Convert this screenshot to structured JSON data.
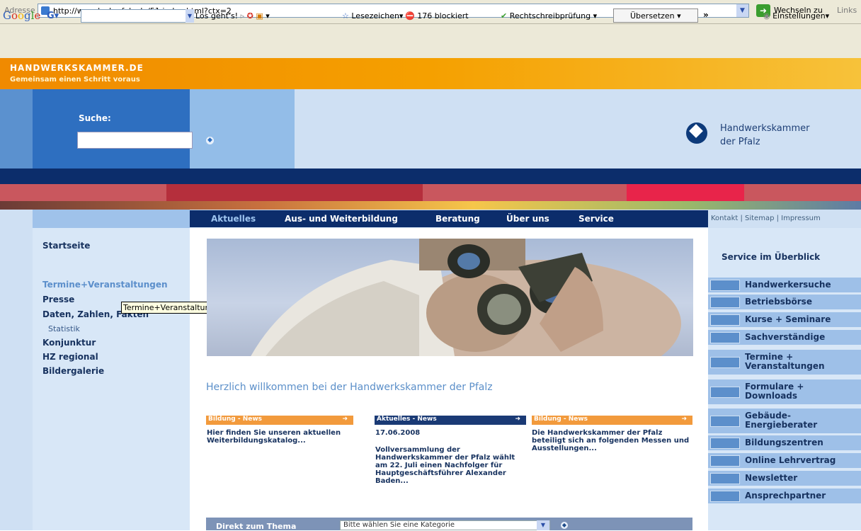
{
  "browser": {
    "address_label": "Adresse",
    "url": "http://www.hwk-pfalz.de/51,index.html?ctx=2",
    "go_label": "Wechseln zu",
    "links_label": "Links"
  },
  "google_toolbar": {
    "logo": "Google",
    "g_button": "G▾",
    "search_go": "Los geht's!",
    "bookmarks": "Lesezeichen▾",
    "blocked": "176 blockiert",
    "spellcheck": "Rechtschreibprüfung ▾",
    "translate": "Übersetzen ▾",
    "more": "»",
    "settings": "Einstellungen▾"
  },
  "site": {
    "brand_title": "HANDWERKSKAMMER.DE",
    "brand_subtitle": "Gemeinsam einen Schritt voraus",
    "search_label": "Suche:",
    "search_go": "◆",
    "org_name_line1": "Handwerkskammer",
    "org_name_line2": "der Pfalz"
  },
  "nav": {
    "items": [
      "Aktuelles",
      "Aus- und Weiterbildung",
      "Beratung",
      "Über uns",
      "Service"
    ],
    "toplinks": "Kontakt | Sitemap | Impressum"
  },
  "left_nav": {
    "start": "Startseite",
    "termine": "Termine+Veranstaltungen",
    "presse": "Presse",
    "daten": "Daten, Zahlen, Fakten",
    "statistik": "Statistik",
    "konjunktur": "Konjunktur",
    "hz": "HZ regional",
    "bilder": "Bildergalerie"
  },
  "tooltip": "Termine+Veranstaltungen",
  "main": {
    "welcome": "Herzlich willkommen bei der Handwerkskammer der Pfalz",
    "news": [
      {
        "label": "Bildung - News",
        "text": "Hier finden Sie unseren aktuellen Weiterbildungskatalog..."
      },
      {
        "label": "Aktuelles - News",
        "date": "17.06.2008",
        "text": "Vollversammlung der Handwerkskammer der Pfalz wählt am 22. Juli einen Nachfolger für Hauptgeschäftsführer Alexander Baden..."
      },
      {
        "label": "Bildung - News",
        "text": "Die Handwerkskammer der Pfalz beteiligt sich an folgenden Messen und Ausstellungen..."
      }
    ],
    "news_arrow": "➜",
    "thema_label": "Direkt zum Thema",
    "thema_select": "Bitte wählen Sie eine Kategorie"
  },
  "service": {
    "title": "Service im Überblick",
    "items": [
      {
        "label": "Handwerkersuche",
        "icon": "tools-icon"
      },
      {
        "label": "Betriebsbörse",
        "icon": "exchange-icon"
      },
      {
        "label": "Kurse + Seminare",
        "icon": "people-icon"
      },
      {
        "label": "Sachverständige",
        "icon": "badge-icon"
      },
      {
        "label": "Termine +",
        "label2": "Veranstaltungen",
        "icon": "calendar-icon"
      },
      {
        "label": "Formulare +",
        "label2": "Downloads",
        "icon": "forms-icon"
      },
      {
        "label": "Gebäude-",
        "label2": "Energieberater",
        "icon": "building-icon"
      },
      {
        "label": "Bildungszentren",
        "icon": "school-icon"
      },
      {
        "label": "Online Lehrvertrag",
        "icon": "contract-icon"
      },
      {
        "label": "Newsletter",
        "icon": "info-icon"
      },
      {
        "label": "Ansprechpartner",
        "icon": "contact-icon"
      }
    ]
  }
}
